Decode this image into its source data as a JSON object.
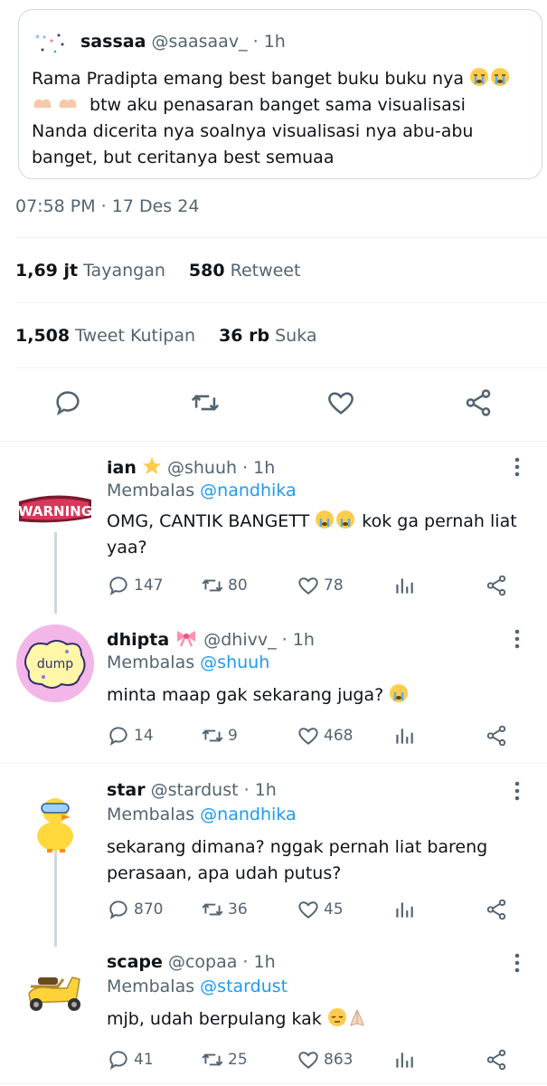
{
  "quoted": {
    "name": "sassaa",
    "handle": "@saasaav_",
    "time": "· 1h",
    "text_line1": "Rama Pradipta emang best banget buku buku nya",
    "text_line2": "btw aku penasaran banget sama visualisasi",
    "text_line3": "Nanda dicerita nya soalnya visualisasi nya abu-abu",
    "text_line4": "banget, but ceritanya best semuaa"
  },
  "timestamp": "07:58 PM · 17 Des 24",
  "stats": {
    "views_value": "1,69 jt",
    "views_label": "Tayangan",
    "retweets_value": "580",
    "retweets_label": "Retweet",
    "quotes_value": "1,508",
    "quotes_label": "Tweet Kutipan",
    "likes_value": "36 rb",
    "likes_label": "Suka"
  },
  "replies": [
    {
      "name": "ian",
      "handle": "@shuuh",
      "time": "· 1h",
      "replying_prefix": "Membalas",
      "replying_to": "@nandhika",
      "text_a": "OMG, CANTIK BANGETT",
      "text_b": "kok ga pernah liat",
      "text_c": "yaa?",
      "avatar_text": "WARNING",
      "replies": "147",
      "retweets": "80",
      "likes": "78"
    },
    {
      "name": "dhipta",
      "handle": "@dhivv_",
      "time": "· 1h",
      "replying_prefix": "Membalas",
      "replying_to": "@shuuh",
      "text_a": "minta maap gak sekarang juga?",
      "avatar_text": "dump",
      "replies": "14",
      "retweets": "9",
      "likes": "468"
    },
    {
      "name": "star",
      "handle": "@stardust",
      "time": "· 1h",
      "replying_prefix": "Membalas",
      "replying_to": "@nandhika",
      "text_a": "sekarang dimana? nggak pernah liat bareng",
      "text_b": "perasaan, apa udah putus?",
      "replies": "870",
      "retweets": "36",
      "likes": "45"
    },
    {
      "name": "scape",
      "handle": "@copaa",
      "time": "· 1h",
      "replying_prefix": "Membalas",
      "replying_to": "@stardust",
      "text_a": "mjb, udah berpulang kak",
      "replies": "41",
      "retweets": "25",
      "likes": "863"
    }
  ],
  "colors": {
    "accent": "#1d9bf0",
    "muted": "#536471",
    "border": "#cfd9de"
  }
}
